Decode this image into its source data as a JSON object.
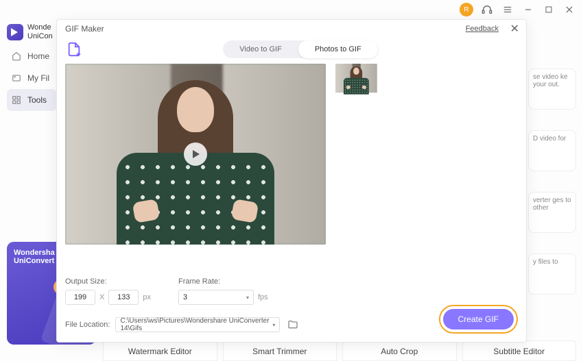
{
  "app": {
    "name_line1": "Wonde",
    "name_line2": "UniCon"
  },
  "sidebar": {
    "items": [
      {
        "label": "Home"
      },
      {
        "label": "My Fil"
      },
      {
        "label": "Tools"
      }
    ]
  },
  "promo": {
    "title_line1": "Wondersha",
    "title_line2": "UniConvert"
  },
  "feature_peek": [
    "se video ke your out.",
    "D video for",
    "verter ges to other",
    "y files to"
  ],
  "bottom_tools": [
    "Watermark Editor",
    "Smart Trimmer",
    "Auto Crop",
    "Subtitle Editor"
  ],
  "modal": {
    "title": "GIF Maker",
    "feedback": "Feedback",
    "tabs": {
      "video": "Video to GIF",
      "photos": "Photos to GIF"
    },
    "output_size_label": "Output Size:",
    "frame_rate_label": "Frame Rate:",
    "width": "199",
    "height": "133",
    "x_sep": "X",
    "px": "px",
    "fps_value": "3",
    "fps_unit": "fps",
    "file_location_label": "File Location:",
    "file_location": "C:\\Users\\ws\\Pictures\\Wondershare UniConverter 14\\Gifs",
    "create_label": "Create GIF"
  }
}
